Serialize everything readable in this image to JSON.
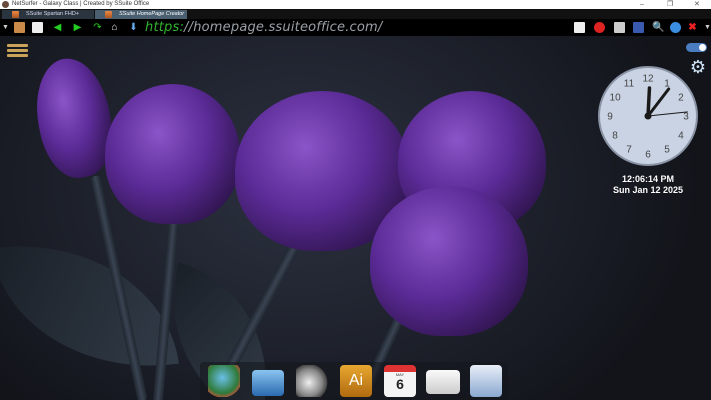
{
  "window": {
    "title": "NetSurfer - Galaxy Class | Created by SSuite Office",
    "controls": [
      "–",
      "❐",
      "✕"
    ]
  },
  "tabs": [
    {
      "label": "SSuite Spartan FHD+ Desktop",
      "active": false
    },
    {
      "label": "SSuite HomePage Creator | C",
      "active": true
    }
  ],
  "toolbar": {
    "url_protocol": "https:",
    "url_rest": "//homepage.ssuiteoffice.com/",
    "left_icons": [
      "dropdown-icon",
      "bookmark-icon",
      "new-tab-icon",
      "back-icon",
      "forward-icon",
      "reload-icon",
      "home-icon",
      "download-icon"
    ],
    "right_icons": [
      "notes-icon",
      "adblock-icon",
      "screenshot-icon",
      "film-icon",
      "search-icon",
      "globe-icon",
      "close-icon",
      "dropdown-icon"
    ]
  },
  "clock": {
    "numbers": [
      "12",
      "1",
      "2",
      "3",
      "4",
      "5",
      "6",
      "7",
      "8",
      "9",
      "10",
      "11"
    ],
    "hours": 12,
    "minutes": 6,
    "seconds": 14,
    "time_text": "12:06:14 PM",
    "date_text": "Sun Jan 12 2025"
  },
  "dock": {
    "items": [
      "globe-app",
      "briefcase-app",
      "media-player-app",
      "illustrator-app",
      "calendar-app",
      "mail-app",
      "writer-app"
    ],
    "calendar_month": "MAY",
    "calendar_day": "6",
    "ai_label": "Ai"
  },
  "colors": {
    "url_green": "#2fb52f",
    "toggle": "#4a7cc0",
    "menu": "#c9a35a"
  }
}
